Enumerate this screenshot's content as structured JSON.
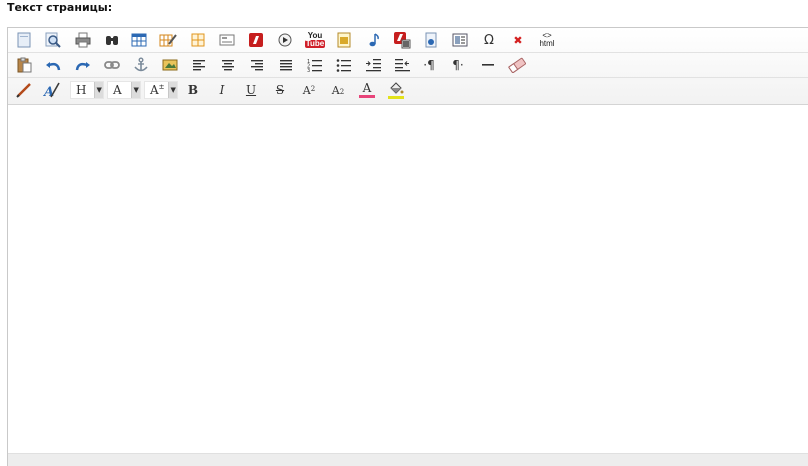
{
  "field": {
    "label": "Текст страницы:"
  },
  "toolbar": {
    "row1": [
      {
        "name": "new-document-button",
        "icon": "new-document-icon"
      },
      {
        "name": "preview-button",
        "icon": "magnifier-icon"
      },
      {
        "name": "print-button",
        "icon": "printer-icon"
      },
      {
        "name": "find-button",
        "icon": "binoculars-icon"
      },
      {
        "name": "insert-table-button",
        "icon": "table-icon"
      },
      {
        "name": "edit-table-button",
        "icon": "table-edit-icon"
      },
      {
        "name": "table-cells-button",
        "icon": "grid-icon"
      },
      {
        "name": "insert-form-button",
        "icon": "form-icon"
      },
      {
        "name": "insert-flash-button",
        "icon": "flash-icon"
      },
      {
        "name": "insert-media-button",
        "icon": "play-icon"
      },
      {
        "name": "insert-youtube-button",
        "icon": "youtube-icon",
        "text_top": "You",
        "text_bottom": "Tube"
      },
      {
        "name": "insert-image-gallery-button",
        "icon": "gallery-icon"
      },
      {
        "name": "insert-audio-button",
        "icon": "music-note-icon"
      },
      {
        "name": "insert-flash-video-button",
        "icon": "flash-video-icon"
      },
      {
        "name": "insert-document-button",
        "icon": "document-icon"
      },
      {
        "name": "page-template-button",
        "icon": "template-icon"
      },
      {
        "name": "special-character-button",
        "icon": "omega-icon",
        "text": "Ω"
      },
      {
        "name": "remove-button",
        "icon": "red-x-icon",
        "text": "✖"
      },
      {
        "name": "html-source-button",
        "icon": "html-icon",
        "text_top": "<>",
        "text_bottom": "html"
      }
    ],
    "row2": [
      {
        "name": "paste-button",
        "icon": "clipboard-icon"
      },
      {
        "name": "undo-button",
        "icon": "undo-icon"
      },
      {
        "name": "redo-button",
        "icon": "redo-icon"
      },
      {
        "name": "insert-link-button",
        "icon": "chain-link-icon"
      },
      {
        "name": "insert-anchor-button",
        "icon": "anchor-icon"
      },
      {
        "name": "insert-image-button",
        "icon": "image-icon"
      },
      {
        "name": "align-left-button",
        "icon": "align-left-icon"
      },
      {
        "name": "align-center-button",
        "icon": "align-center-icon"
      },
      {
        "name": "align-right-button",
        "icon": "align-right-icon"
      },
      {
        "name": "align-justify-button",
        "icon": "align-justify-icon"
      },
      {
        "name": "numbered-list-button",
        "icon": "numbered-list-icon"
      },
      {
        "name": "bulleted-list-button",
        "icon": "bulleted-list-icon"
      },
      {
        "name": "indent-button",
        "icon": "indent-icon"
      },
      {
        "name": "outdent-button",
        "icon": "outdent-icon"
      },
      {
        "name": "ltr-paragraph-button",
        "icon": "paragraph-ltr-icon",
        "text": "·¶"
      },
      {
        "name": "rtl-paragraph-button",
        "icon": "paragraph-rtl-icon",
        "text": "¶·"
      },
      {
        "name": "horizontal-rule-button",
        "icon": "horizontal-rule-icon"
      },
      {
        "name": "clear-formatting-button",
        "icon": "eraser-icon"
      }
    ],
    "row3": {
      "pencil_icon": "pencil-icon",
      "styles_icon": "style-paint-icon",
      "heading_select": "H",
      "font_select": "A",
      "size_select": "A",
      "size_superscript": "±",
      "bold": "B",
      "italic": "I",
      "underline": "U",
      "strike": "S",
      "superscript_base": "A",
      "superscript_mark": "2",
      "subscript_base": "A",
      "subscript_mark": "2",
      "font_color": "A",
      "font_color_bar": "#e8447a",
      "bg_color_bar": "#e2e21a"
    }
  }
}
